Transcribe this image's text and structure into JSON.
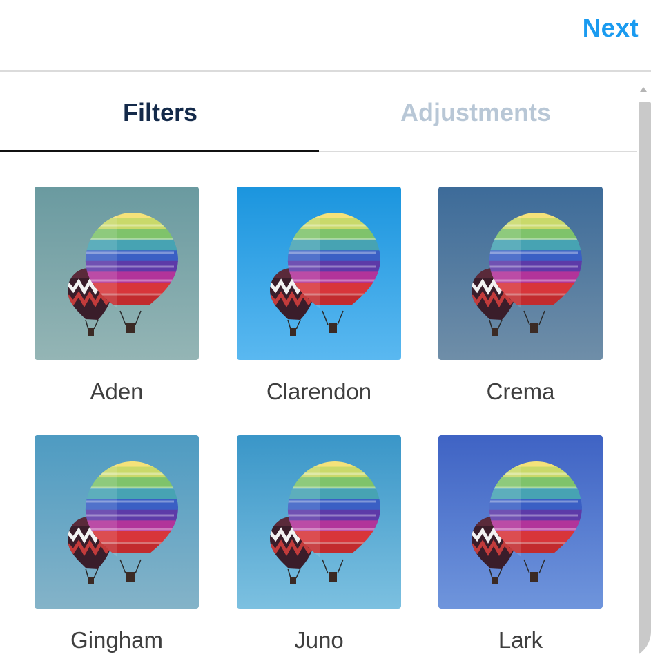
{
  "header": {
    "next_label": "Next"
  },
  "tabs": [
    {
      "label": "Filters",
      "active": true
    },
    {
      "label": "Adjustments",
      "active": false
    }
  ],
  "filters": [
    {
      "name": "Aden",
      "bg_top": "#6a9aa0",
      "bg_bottom": "#94b5b5"
    },
    {
      "name": "Clarendon",
      "bg_top": "#1b95de",
      "bg_bottom": "#5ab8f0"
    },
    {
      "name": "Crema",
      "bg_top": "#3d6b99",
      "bg_bottom": "#6f8ea8"
    },
    {
      "name": "Gingham",
      "bg_top": "#4e9bc2",
      "bg_bottom": "#84b3c8"
    },
    {
      "name": "Juno",
      "bg_top": "#3a96c8",
      "bg_bottom": "#7cc0e0"
    },
    {
      "name": "Lark",
      "bg_top": "#3f63c4",
      "bg_bottom": "#6f95dc"
    }
  ],
  "colors": {
    "accent": "#1a9bf0",
    "active_tab": "#142a4a",
    "inactive_tab": "#b8c7d6"
  },
  "icons": {
    "scroll_up": "triangle-up-icon"
  }
}
